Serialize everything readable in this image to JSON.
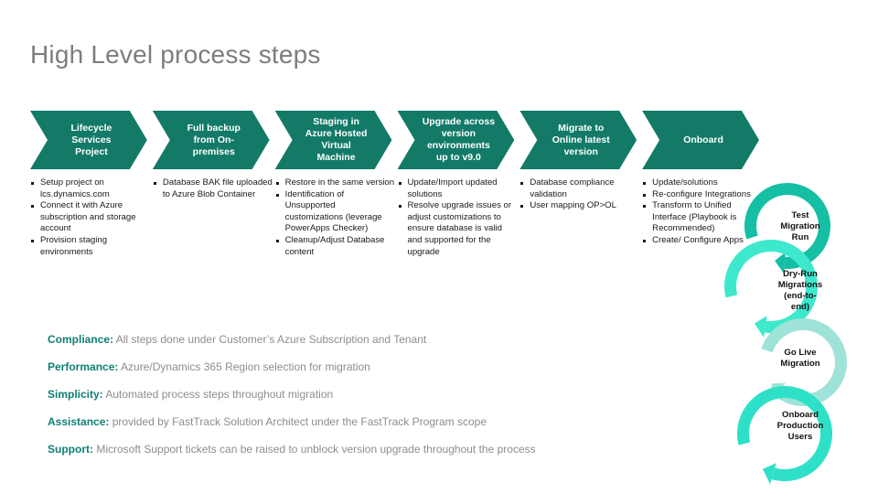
{
  "page": {
    "title": "High Level process steps",
    "background": "#ffffff",
    "accent_dark_teal": "#137a68",
    "accent_label_teal": "#0f8074",
    "body_gray": "#8d8d8d",
    "title_gray": "#7d7d7d"
  },
  "process": {
    "steps": [
      {
        "label": "Lifecycle\nServices\nProject"
      },
      {
        "label": "Full backup\nfrom On-\npremises"
      },
      {
        "label": "Staging in\nAzure Hosted\nVirtual\nMachine"
      },
      {
        "label": "Upgrade across\nversion\nenvironments\nup to v9.0"
      },
      {
        "label": "Migrate to\nOnline latest\nversion"
      },
      {
        "label": "Onboard"
      }
    ]
  },
  "details": {
    "columns": [
      {
        "name": "lifecycle-services-project-details",
        "bullets": [
          "Setup project on lcs.dynamics.com",
          "Connect it with Azure subscription and storage account",
          "Provision staging environments"
        ]
      },
      {
        "name": "full-backup-details",
        "bullets": [
          "Database BAK file uploaded to Azure Blob Container"
        ]
      },
      {
        "name": "staging-azure-vm-details",
        "bullets": [
          "Restore in the same version",
          "Identification of Unsupported customizations (leverage PowerApps Checker)",
          "Cleanup/Adjust Database content"
        ]
      },
      {
        "name": "upgrade-across-versions-details",
        "bullets": [
          "Update/Import updated solutions",
          "Resolve upgrade issues or adjust customizations to ensure database is valid and supported for the upgrade"
        ]
      },
      {
        "name": "migrate-online-details",
        "bullets": [
          "Database compliance validation",
          "User mapping OP>OL"
        ]
      },
      {
        "name": "onboard-details",
        "bullets": [
          "Update/solutions",
          "Re-configure Integrations",
          "Transform to Unified Interface (Playbook is Recommended)",
          "Create/ Configure Apps"
        ]
      }
    ]
  },
  "benefits": [
    {
      "key": "Compliance:",
      "value": "All steps done under Customer’s Azure Subscription and Tenant"
    },
    {
      "key": "Performance:",
      "value": "Azure/Dynamics 365 Region selection for migration"
    },
    {
      "key": "Simplicity:",
      "value": "Automated process steps throughout migration"
    },
    {
      "key": "Assistance:",
      "value": "provided by FastTrack Solution Architect under the FastTrack Program scope"
    },
    {
      "key": "Support:",
      "value": "Microsoft Support tickets can be raised to unblock version upgrade throughout the process"
    }
  ],
  "cycles": [
    {
      "label": "Test\nMigration\nRun",
      "color": "#14bfa4"
    },
    {
      "label": "Dry-Run\nMigrations\n(end-to-\nend)",
      "color": "#3ee8cc"
    },
    {
      "label": "Go Live\nMigration",
      "color": "#9fe3d8"
    },
    {
      "label": "Onboard\nProduction\nUsers",
      "color": "#2fe0c8"
    }
  ]
}
